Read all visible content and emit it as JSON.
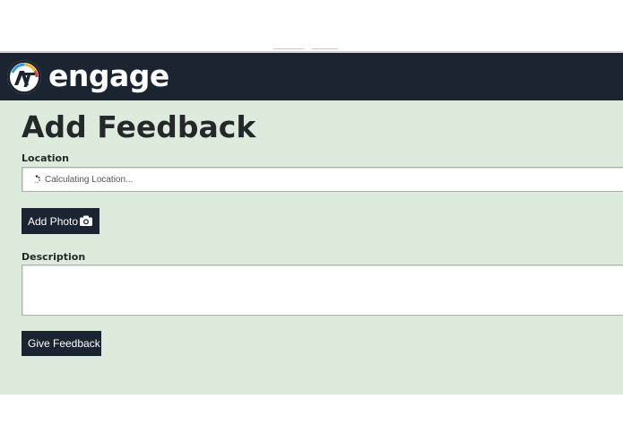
{
  "header": {
    "brand": "engage",
    "logo_text": "AT",
    "colors": {
      "bar": "#1b2431",
      "text": "#ffffff"
    }
  },
  "main": {
    "title": "Add Feedback",
    "background": "#dcebdc",
    "location": {
      "label": "Location",
      "status": "Calculating Location..."
    },
    "add_photo_button": {
      "label": "Add Photo",
      "icon": "camera-icon"
    },
    "description": {
      "label": "Description",
      "value": ""
    },
    "give_feedback_button": {
      "label": "Give Feedback"
    }
  }
}
